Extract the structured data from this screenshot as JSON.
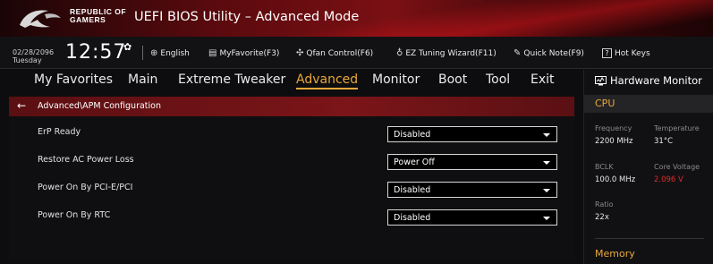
{
  "header": {
    "brand_line1": "REPUBLIC OF",
    "brand_line2": "GAMERS",
    "title": "UEFI BIOS Utility – Advanced Mode"
  },
  "toolbar": {
    "date": "02/28/2096",
    "day": "Tuesday",
    "time": "12:57",
    "items": [
      {
        "icon": "globe-icon",
        "label": "English"
      },
      {
        "icon": "favorite-icon",
        "label": "MyFavorite(F3)"
      },
      {
        "icon": "fan-icon",
        "label": "Qfan Control(F6)"
      },
      {
        "icon": "lightbulb-icon",
        "label": "EZ Tuning Wizard(F11)"
      },
      {
        "icon": "note-icon",
        "label": "Quick Note(F9)"
      },
      {
        "icon": "hotkey-icon",
        "label": "Hot Keys"
      }
    ]
  },
  "nav": {
    "items": [
      "My Favorites",
      "Main",
      "Extreme Tweaker",
      "Advanced",
      "Monitor",
      "Boot",
      "Tool",
      "Exit"
    ],
    "active": "Advanced"
  },
  "breadcrumb": "Advanced\\APM Configuration",
  "settings": [
    {
      "label": "ErP Ready",
      "value": "Disabled"
    },
    {
      "label": "Restore AC Power Loss",
      "value": "Power Off"
    },
    {
      "label": "Power On By PCI-E/PCI",
      "value": "Disabled"
    },
    {
      "label": "Power On By RTC",
      "value": "Disabled"
    }
  ],
  "hardware_monitor": {
    "title": "Hardware Monitor",
    "cpu_section": "CPU",
    "frequency_label": "Frequency",
    "frequency_value": "2200 MHz",
    "temperature_label": "Temperature",
    "temperature_value": "31°C",
    "bclk_label": "BCLK",
    "bclk_value": "100.0 MHz",
    "core_voltage_label": "Core Voltage",
    "core_voltage_value": "2.096 V",
    "ratio_label": "Ratio",
    "ratio_value": "22x",
    "memory_section": "Memory"
  },
  "colors": {
    "accent": "#e9a83b",
    "header_red": "#7a1014",
    "voltage_warning": "#e02a2a"
  }
}
